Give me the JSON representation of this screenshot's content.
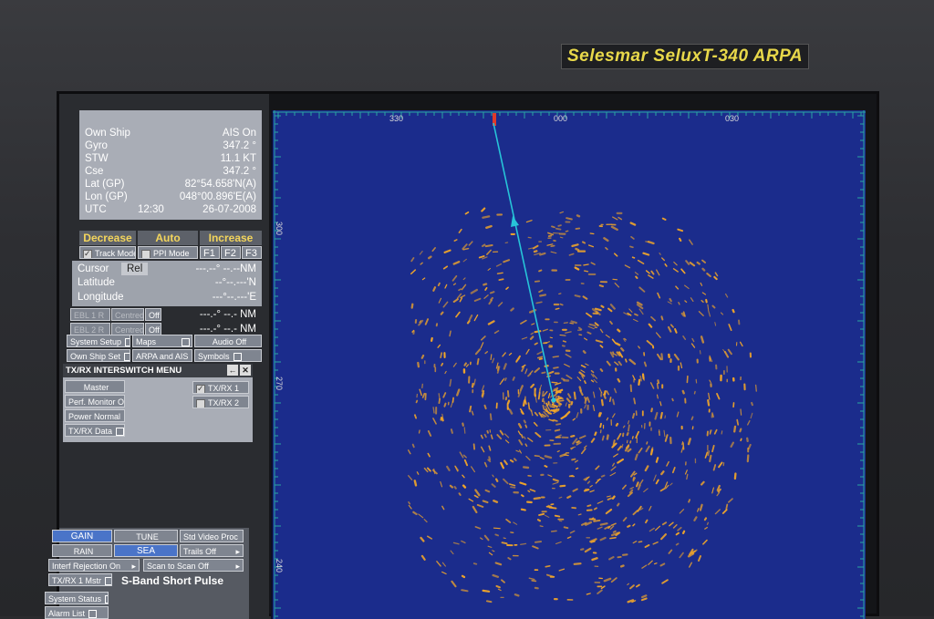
{
  "brand": "Selesmar SeluxT-340 ARPA",
  "ownship": {
    "title": "Own Ship",
    "ais": "AIS On",
    "rows": [
      {
        "label": "Gyro",
        "value": "347.2   °"
      },
      {
        "label": "STW",
        "value": "11.1   KT"
      },
      {
        "label": "Cse",
        "value": "347.2   °"
      },
      {
        "label": "Lat (GP)",
        "value": "82°54.658'N(A)"
      },
      {
        "label": "Lon (GP)",
        "value": "048°00.896'E(A)"
      },
      {
        "label": "UTC",
        "value": "26-07-2008",
        "time": "12:30"
      }
    ]
  },
  "controls": {
    "decrease": "Decrease",
    "auto": "Auto",
    "increase": "Increase",
    "track_mode": "Track Mode",
    "ppi_mode": "PPI Mode",
    "f1": "F1",
    "f2": "F2",
    "f3": "F3"
  },
  "cursor": {
    "label": "Cursor",
    "rel": "Rel",
    "cursor_value": "---.--°     --.--NM",
    "latitude_label": "Latitude",
    "latitude_value": "--°--.---'N",
    "longitude_label": "Longitude",
    "longitude_value": "---°--.---'E"
  },
  "ebl": [
    {
      "name": "EBL 1 R",
      "mode": "Centred",
      "state": "Off",
      "value": "---.-°  --.-   NM"
    },
    {
      "name": "EBL 2 R",
      "mode": "Centred",
      "state": "Off",
      "value": "---.-°  --.-   NM"
    }
  ],
  "menu_buttons": [
    {
      "label": "System Setup"
    },
    {
      "label": "Maps"
    },
    {
      "label": "Audio Off"
    },
    {
      "label": "Own Ship Set"
    },
    {
      "label": "ARPA and AIS"
    },
    {
      "label": "Symbols"
    }
  ],
  "txrx": {
    "title": "TX/RX INTERSWITCH MENU",
    "master": "Master",
    "perf": "Perf. Monitor Off",
    "power": "Power Normal",
    "data": "TX/RX Data",
    "rx1": "TX/RX 1",
    "rx2": "TX/RX 2"
  },
  "bottom": {
    "gain": "GAIN",
    "tune": "TUNE",
    "video": "Std Video Proc",
    "rain": "RAIN",
    "sea": "SEA",
    "trails": "Trails Off",
    "interf": "Interf Rejection On",
    "scan": "Scan to Scan Off",
    "mstr": "TX/RX 1 Mstr",
    "band": "S-Band Short Pulse",
    "status": "System Status",
    "alarm": "Alarm List"
  },
  "radar": {
    "bearings_top": [
      "330",
      "000",
      "030"
    ],
    "bearings_left": [
      "300",
      "270",
      "240"
    ],
    "echo_color": "#f0a52a",
    "heading_line_color": "#27c4d8",
    "background_color": "#1b2c8c"
  }
}
